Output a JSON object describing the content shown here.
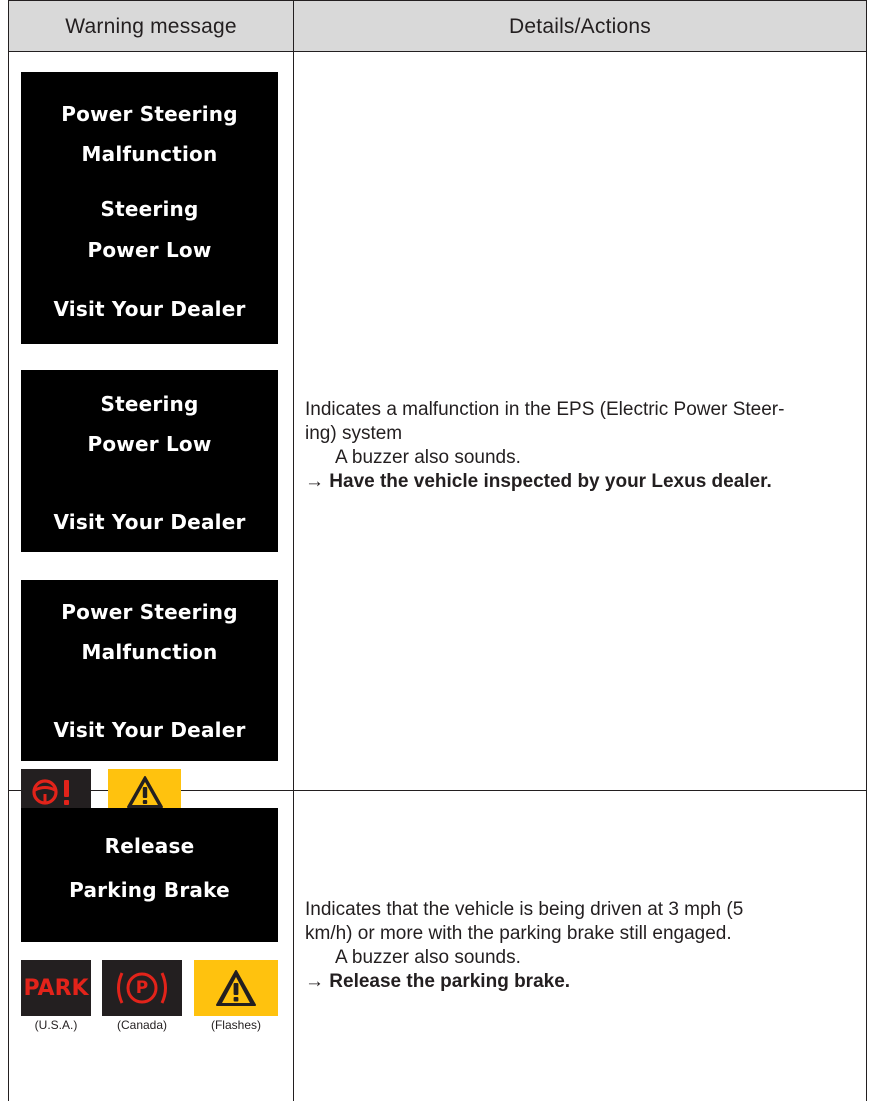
{
  "table": {
    "header": {
      "col1": "Warning message",
      "col2": "Details/Actions"
    },
    "rows": [
      {
        "messages": [
          {
            "lines": [
              "Power Steering",
              "Malfunction",
              "Steering",
              "Power Low",
              "Visit Your Dealer"
            ]
          },
          {
            "lines": [
              "Steering",
              "Power Low",
              "Visit Your Dealer"
            ]
          },
          {
            "lines": [
              "Power Steering",
              "Malfunction",
              "Visit Your Dealer"
            ]
          }
        ],
        "icons": [
          {
            "icon": "steering-warning-icon",
            "color": "#e2231a"
          },
          {
            "icon": "warning-triangle-icon",
            "color": "#231f20"
          }
        ],
        "details": {
          "line1": "Indicates a malfunction in the EPS (Electric Power Steer-",
          "line2": "ing) system",
          "line3": "A buzzer also sounds.",
          "action": "→ Have the vehicle inspected by your Lexus dealer."
        }
      },
      {
        "messages": [
          {
            "lines": [
              "Release",
              "Parking Brake"
            ]
          }
        ],
        "icons": [
          {
            "icon": "park-text-icon",
            "text": "PARK",
            "caption": "(U.S.A.)",
            "color": "#e2231a"
          },
          {
            "icon": "parking-brake-circle-icon",
            "text": "P",
            "caption": "(Canada)",
            "color": "#e2231a"
          },
          {
            "icon": "warning-triangle-icon",
            "caption": "(Flashes)",
            "color": "#231f20"
          }
        ],
        "details": {
          "line1": "Indicates that the vehicle is being driven at 3 mph (5",
          "line2": "km/h) or more with the parking brake still engaged.",
          "line3": "A buzzer also sounds.",
          "action": "→ Release the parking brake."
        }
      }
    ]
  }
}
